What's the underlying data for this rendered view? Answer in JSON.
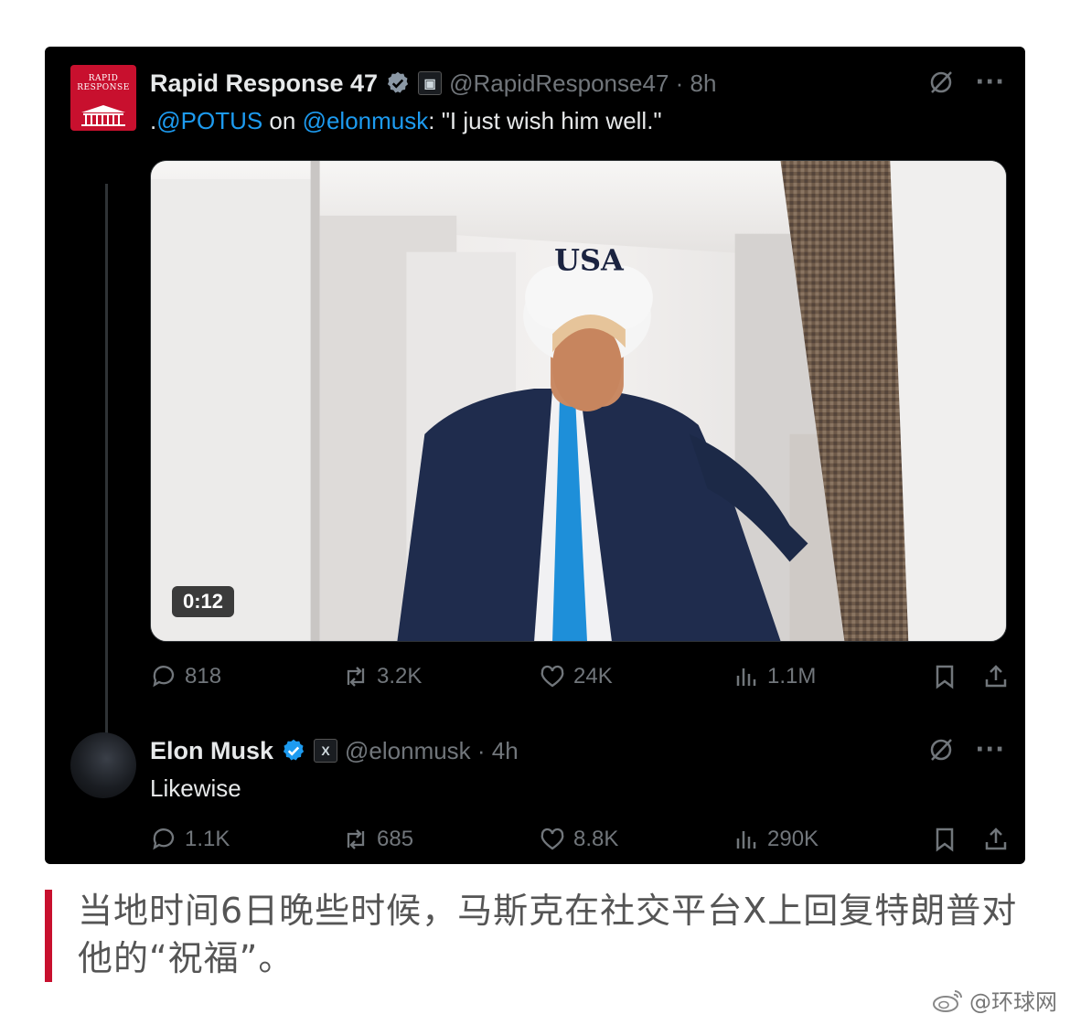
{
  "tweet1": {
    "avatar_text": "RAPID RESPONSE",
    "name": "Rapid Response 47",
    "handle_time": "@RapidResponse47 · 8h",
    "text_prefix": ".",
    "mention1": "@POTUS",
    "text_mid": " on ",
    "mention2": "@elonmusk",
    "text_suffix": ": \"I just wish him well.\"",
    "video_duration": "0:12",
    "cap_text": "USA",
    "stats": {
      "replies": "818",
      "reposts": "3.2K",
      "likes": "24K",
      "views": "1.1M"
    }
  },
  "tweet2": {
    "name": "Elon Musk",
    "affiliation_badge": "X",
    "handle_time": "@elonmusk · 4h",
    "text": "Likewise",
    "stats": {
      "replies": "1.1K",
      "reposts": "685",
      "likes": "8.8K",
      "views": "290K"
    }
  },
  "icons": {
    "verified": "verified-badge-icon",
    "affiliate": "affiliation-badge-icon",
    "grok": "grok-icon",
    "more": "more-icon",
    "reply": "reply-icon",
    "repost": "repost-icon",
    "like": "heart-icon",
    "views": "views-icon",
    "bookmark": "bookmark-icon",
    "share": "share-icon"
  },
  "caption": {
    "text": "当地时间6日晚些时候，马斯克在社交平台X上回复特朗普对他的“祝福”。"
  },
  "watermark": {
    "text": "@环球网"
  },
  "colors": {
    "background": "#000000",
    "text": "#e7e9ea",
    "secondary": "#71767b",
    "mention": "#1d9bf0",
    "verified": "#1d9bf0",
    "caption_bar": "#c8102e"
  }
}
